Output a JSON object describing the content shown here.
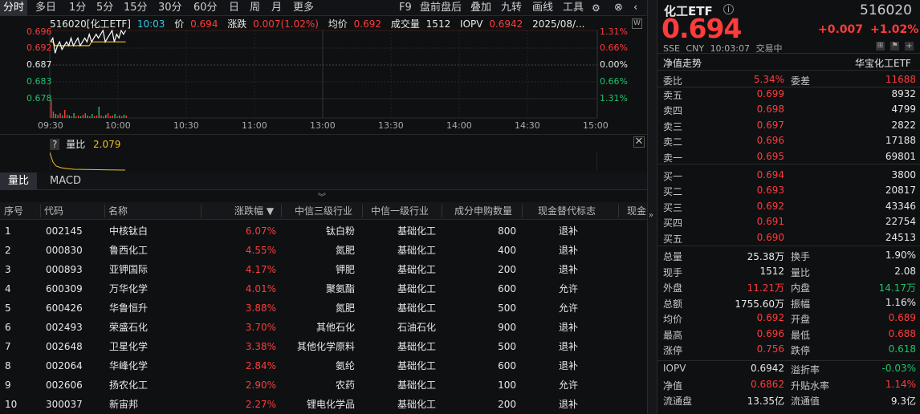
{
  "toolbar": {
    "left": [
      "分时",
      "多日",
      "1分",
      "5分",
      "15分",
      "30分",
      "60分",
      "日",
      "周",
      "月",
      "更多"
    ],
    "right": [
      "F9",
      "盘前盘后",
      "叠加",
      "九转",
      "画线",
      "工具"
    ]
  },
  "chart_header": {
    "code_name": "516020[化工ETF]",
    "time": "10:03",
    "price_label": "价",
    "price": "0.694",
    "change_label": "涨跌",
    "change": "0.007(1.02%)",
    "avg_label": "均价",
    "avg": "0.692",
    "volume_label": "成交量",
    "volume": "1512",
    "iopv_label": "IOPV",
    "iopv": "0.6942",
    "date": "2025/08/..."
  },
  "chart_data": {
    "type": "line",
    "y_ticks": [
      "0.696",
      "0.692",
      "0.687",
      "0.683",
      "0.678"
    ],
    "pct_ticks": [
      "1.31%",
      "0.66%",
      "0.00%",
      "0.66%",
      "1.31%"
    ],
    "x_ticks": [
      "09:30",
      "10:00",
      "10:30",
      "11:00",
      "13:00",
      "13:30",
      "14:00",
      "14:30",
      "15:00"
    ],
    "prev_close": 0.687,
    "ylim": [
      0.678,
      0.696
    ],
    "price": [
      0.693,
      0.694,
      0.69,
      0.692,
      0.693,
      0.691,
      0.692,
      0.693,
      0.692,
      0.694,
      0.692,
      0.693,
      0.694,
      0.692,
      0.693,
      0.694,
      0.693,
      0.695,
      0.693,
      0.694,
      0.695,
      0.694,
      0.695,
      0.696,
      0.693,
      0.694,
      0.695,
      0.696,
      0.693,
      0.695,
      0.694,
      0.696,
      0.695,
      0.696
    ],
    "avg": [
      0.693,
      0.693,
      0.692,
      0.692,
      0.692,
      0.692,
      0.692,
      0.692,
      0.692,
      0.692,
      0.692,
      0.692,
      0.692,
      0.692,
      0.692,
      0.692,
      0.692,
      0.692,
      0.693,
      0.693,
      0.693,
      0.693,
      0.693,
      0.693,
      0.693,
      0.693,
      0.693,
      0.693,
      0.693,
      0.693,
      0.693,
      0.693,
      0.693,
      0.693
    ],
    "volume": [
      22,
      8,
      5,
      4,
      6,
      3,
      10,
      4,
      3,
      2,
      6,
      2,
      3,
      2,
      4,
      6,
      3,
      2,
      5,
      2,
      3,
      14,
      3,
      2,
      4,
      6,
      2,
      3,
      5,
      2,
      3,
      2,
      4,
      3
    ]
  },
  "ratio_panel": {
    "help": "?",
    "label": "量比",
    "value": "2.079"
  },
  "tabs": [
    "量比",
    "MACD"
  ],
  "table": {
    "headers": [
      "序号",
      "代码",
      "名称",
      "涨跌幅 ▼",
      "中信三级行业",
      "中信一级行业",
      "成分申购数量",
      "现金替代标志",
      "现金"
    ],
    "rows": [
      [
        "1",
        "002145",
        "中核钛白",
        "6.07%",
        "钛白粉",
        "基础化工",
        "800",
        "退补"
      ],
      [
        "2",
        "000830",
        "鲁西化工",
        "4.55%",
        "氮肥",
        "基础化工",
        "400",
        "退补"
      ],
      [
        "3",
        "000893",
        "亚钾国际",
        "4.17%",
        "钾肥",
        "基础化工",
        "200",
        "退补"
      ],
      [
        "4",
        "600309",
        "万华化学",
        "4.01%",
        "聚氨酯",
        "基础化工",
        "600",
        "允许"
      ],
      [
        "5",
        "600426",
        "华鲁恒升",
        "3.88%",
        "氮肥",
        "基础化工",
        "500",
        "允许"
      ],
      [
        "6",
        "002493",
        "荣盛石化",
        "3.70%",
        "其他石化",
        "石油石化",
        "900",
        "退补"
      ],
      [
        "7",
        "002648",
        "卫星化学",
        "3.38%",
        "其他化学原料",
        "基础化工",
        "500",
        "退补"
      ],
      [
        "8",
        "002064",
        "华峰化学",
        "2.84%",
        "氨纶",
        "基础化工",
        "600",
        "退补"
      ],
      [
        "9",
        "002606",
        "扬农化工",
        "2.90%",
        "农药",
        "基础化工",
        "100",
        "允许"
      ],
      [
        "10",
        "300037",
        "新宙邦",
        "2.27%",
        "锂电化学品",
        "基础化工",
        "200",
        "退补"
      ]
    ]
  },
  "quote": {
    "name": "化工ETF",
    "code": "516020",
    "price": "0.694",
    "change": "+0.007",
    "change_pct": "+1.02%",
    "exchange": "SSE",
    "currency": "CNY",
    "time": "10:03:07",
    "status": "交易中",
    "nav_trend": "净值走势",
    "fund_company": "华宝化工ETF",
    "weibi_label": "委比",
    "weibi": "5.34%",
    "weicha_label": "委差",
    "weicha": "11688",
    "asks": [
      [
        "卖五",
        "0.699",
        "8932"
      ],
      [
        "卖四",
        "0.698",
        "4799"
      ],
      [
        "卖三",
        "0.697",
        "2822"
      ],
      [
        "卖二",
        "0.696",
        "17188"
      ],
      [
        "卖一",
        "0.695",
        "69801"
      ]
    ],
    "bids": [
      [
        "买一",
        "0.694",
        "3800"
      ],
      [
        "买二",
        "0.693",
        "20817"
      ],
      [
        "买三",
        "0.692",
        "43346"
      ],
      [
        "买四",
        "0.691",
        "22754"
      ],
      [
        "买五",
        "0.690",
        "24513"
      ]
    ],
    "stats": [
      [
        "总量",
        "25.38万",
        "换手",
        "1.90%"
      ],
      [
        "现手",
        "1512",
        "量比",
        "2.08"
      ],
      [
        "外盘",
        "11.21万",
        "内盘",
        "14.17万"
      ],
      [
        "总额",
        "1755.60万",
        "振幅",
        "1.16%"
      ],
      [
        "均价",
        "0.692",
        "开盘",
        "0.689"
      ],
      [
        "最高",
        "0.696",
        "最低",
        "0.688"
      ],
      [
        "涨停",
        "0.756",
        "跌停",
        "0.618"
      ]
    ],
    "extra": [
      [
        "IOPV",
        "0.6942",
        "溢折率",
        "-0.03%"
      ],
      [
        "净值",
        "0.6862",
        "升贴水率",
        "1.14%"
      ],
      [
        "流通盘",
        "13.35亿",
        "流通值",
        "9.3亿"
      ]
    ]
  },
  "colors": {
    "up": "#ff3b3b",
    "down": "#1ec36a",
    "price_line": "#ffffff",
    "avg_line": "#f0c020"
  }
}
